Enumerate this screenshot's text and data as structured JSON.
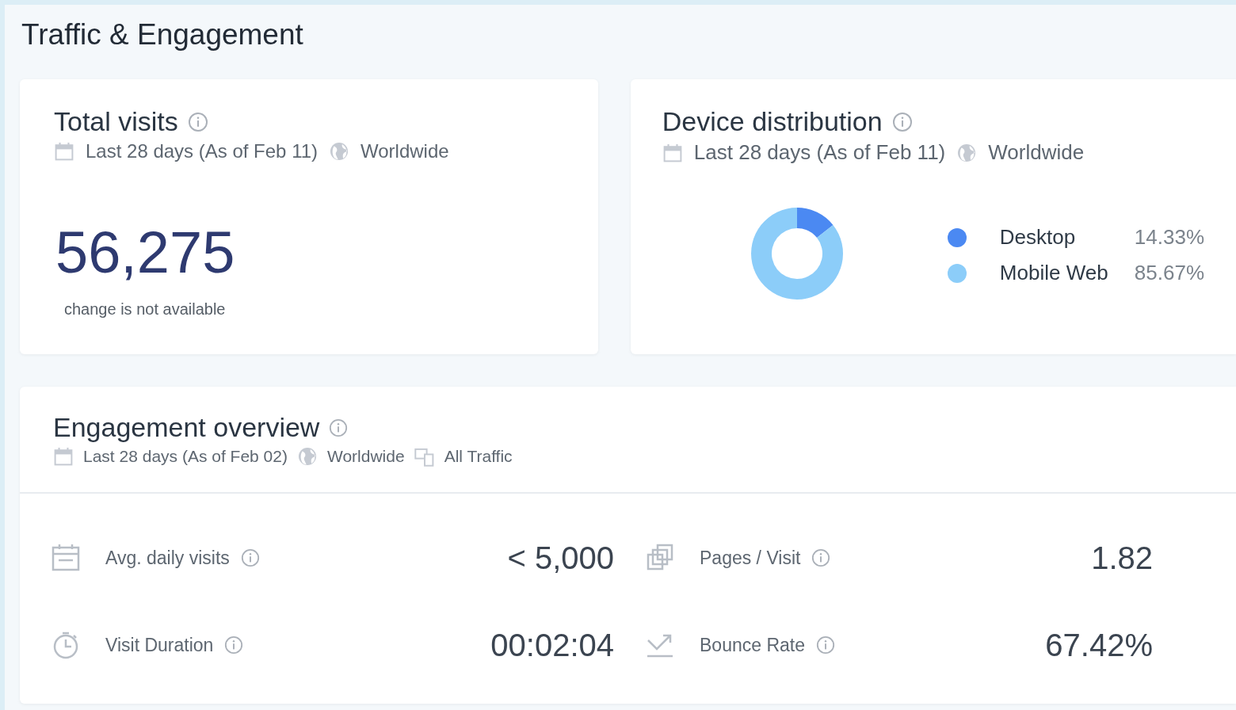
{
  "title": "Traffic & Engagement",
  "total_visits": {
    "title": "Total visits",
    "period": "Last 28 days (As of Feb 11)",
    "region": "Worldwide",
    "value": "56,275",
    "change": "change is not available"
  },
  "device_distribution": {
    "title": "Device distribution",
    "period": "Last 28 days (As of Feb 11)",
    "region": "Worldwide",
    "chart_data": {
      "type": "donut",
      "categories": [
        "Desktop",
        "Mobile Web"
      ],
      "values": [
        14.33,
        85.67
      ]
    },
    "legend": [
      {
        "value": "14.33%",
        "color": "#4b89f2"
      },
      {
        "value": "85.67%",
        "color": "#8ccdf9"
      }
    ]
  },
  "engagement": {
    "title": "Engagement overview",
    "period": "Last 28 days (As of Feb 02)",
    "region": "Worldwide",
    "traffic": "All Traffic",
    "metrics": [
      {
        "kind": "calendar",
        "label": "Avg. daily visits",
        "value": "< 5,000"
      },
      {
        "kind": "pages",
        "label": "Pages / Visit",
        "value": "1.82"
      },
      {
        "kind": "timer",
        "label": "Visit Duration",
        "value": "00:02:04"
      },
      {
        "kind": "bounce",
        "label": "Bounce Rate",
        "value": "67.42%"
      }
    ]
  }
}
